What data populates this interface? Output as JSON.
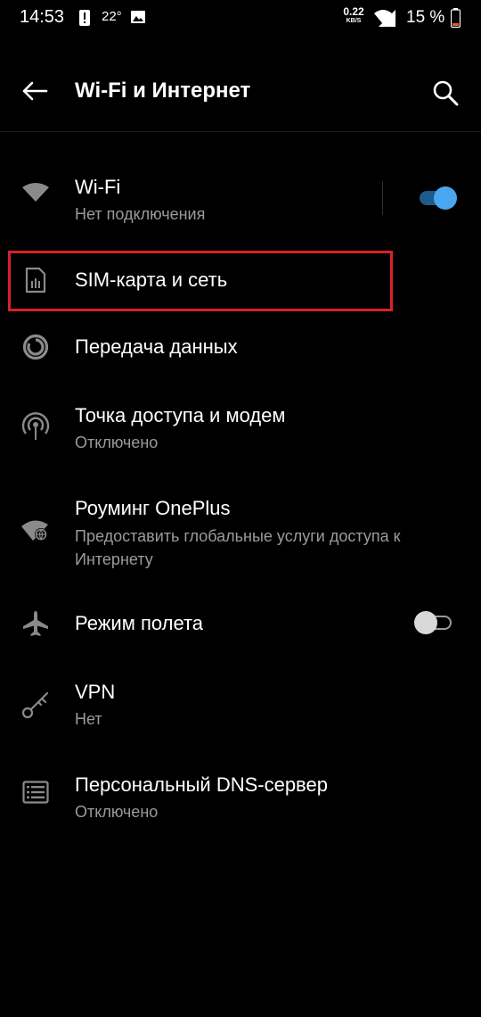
{
  "status_bar": {
    "time": "14:53",
    "temperature": "22°",
    "net_speed_value": "0.22",
    "net_speed_unit": "KB/S",
    "battery": "15 %",
    "icons": [
      "alert-icon",
      "image-icon",
      "wifi-icon",
      "signal-icon",
      "battery-icon"
    ],
    "battery_color": "#e8542f"
  },
  "app_bar": {
    "title": "Wi-Fi и Интернет",
    "back_icon": "arrow-left-icon",
    "search_icon": "search-icon"
  },
  "accent_color": "#4aa6ee",
  "highlight_color": "#d52328",
  "settings": [
    {
      "icon": "wifi-icon",
      "title": "Wi-Fi",
      "subtitle": "Нет подключения",
      "toggle": true
    },
    {
      "icon": "sim-card-icon",
      "title": "SIM-карта и сеть",
      "highlighted": true
    },
    {
      "icon": "data-usage-icon",
      "title": "Передача данных"
    },
    {
      "icon": "hotspot-icon",
      "title": "Точка доступа и модем",
      "subtitle": "Отключено"
    },
    {
      "icon": "roaming-icon",
      "title": "Роуминг OnePlus",
      "subtitle": "Предоставить глобальные услуги доступа к Интернету"
    },
    {
      "icon": "airplane-icon",
      "title": "Режим полета",
      "toggle": false
    },
    {
      "icon": "vpn-key-icon",
      "title": "VPN",
      "subtitle": "Нет"
    },
    {
      "icon": "dns-icon",
      "title": "Персональный DNS-сервер",
      "subtitle": "Отключено"
    }
  ]
}
